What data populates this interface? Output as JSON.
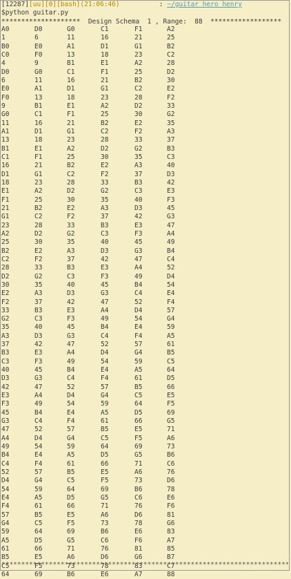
{
  "header": {
    "pid": "[12287]",
    "tag": "[uu][0][bash](21:06:46)",
    "sep": "          : ",
    "path": "~/guitar hero henry"
  },
  "command": "$python guitar.py",
  "schema_line": {
    "left_stars": "********************",
    "text": "  Design Schema  1 , Range:  88  ",
    "right_stars": "******************"
  },
  "rows": [
    [
      "A0",
      "D0",
      "G0",
      "C1",
      "F1",
      "A2"
    ],
    [
      "1",
      "6",
      "11",
      "16",
      "21",
      "25"
    ],
    [
      "B0",
      "E0",
      "A1",
      "D1",
      "G1",
      "B2"
    ],
    [
      "C0",
      "F0",
      "13",
      "18",
      "23",
      "C2"
    ],
    [
      "4",
      "9",
      "B1",
      "E1",
      "A2",
      "28"
    ],
    [
      "D0",
      "G0",
      "C1",
      "F1",
      "25",
      "D2"
    ],
    [
      "6",
      "11",
      "16",
      "21",
      "B2",
      "30"
    ],
    [
      "E0",
      "A1",
      "D1",
      "G1",
      "C2",
      "E2"
    ],
    [
      "F0",
      "13",
      "18",
      "23",
      "28",
      "F2"
    ],
    [
      "9",
      "B1",
      "E1",
      "A2",
      "D2",
      "33"
    ],
    [
      "G0",
      "C1",
      "F1",
      "25",
      "30",
      "G2"
    ],
    [
      "11",
      "16",
      "21",
      "B2",
      "E2",
      "35"
    ],
    [
      "A1",
      "D1",
      "G1",
      "C2",
      "F2",
      "A3"
    ],
    [
      "13",
      "18",
      "23",
      "28",
      "33",
      "37"
    ],
    [
      "B1",
      "E1",
      "A2",
      "D2",
      "G2",
      "B3"
    ],
    [
      "C1",
      "F1",
      "25",
      "30",
      "35",
      "C3"
    ],
    [
      "16",
      "21",
      "B2",
      "E2",
      "A3",
      "40"
    ],
    [
      "D1",
      "G1",
      "C2",
      "F2",
      "37",
      "D3"
    ],
    [
      "18",
      "23",
      "28",
      "33",
      "B3",
      "42"
    ],
    [
      "E1",
      "A2",
      "D2",
      "G2",
      "C3",
      "E3"
    ],
    [
      "F1",
      "25",
      "30",
      "35",
      "40",
      "F3"
    ],
    [
      "21",
      "B2",
      "E2",
      "A3",
      "D3",
      "45"
    ],
    [
      "G1",
      "C2",
      "F2",
      "37",
      "42",
      "G3"
    ],
    [
      "23",
      "28",
      "33",
      "B3",
      "E3",
      "47"
    ],
    [
      "A2",
      "D2",
      "G2",
      "C3",
      "F3",
      "A4"
    ],
    [
      "25",
      "30",
      "35",
      "40",
      "45",
      "49"
    ],
    [
      "B2",
      "E2",
      "A3",
      "D3",
      "G3",
      "B4"
    ],
    [
      "C2",
      "F2",
      "37",
      "42",
      "47",
      "C4"
    ],
    [
      "28",
      "33",
      "B3",
      "E3",
      "A4",
      "52"
    ],
    [
      "D2",
      "G2",
      "C3",
      "F3",
      "49",
      "D4"
    ],
    [
      "30",
      "35",
      "40",
      "45",
      "B4",
      "54"
    ],
    [
      "E2",
      "A3",
      "D3",
      "G3",
      "C4",
      "E4"
    ],
    [
      "F2",
      "37",
      "42",
      "47",
      "52",
      "F4"
    ],
    [
      "33",
      "B3",
      "E3",
      "A4",
      "D4",
      "57"
    ],
    [
      "G2",
      "C3",
      "F3",
      "49",
      "54",
      "G4"
    ],
    [
      "35",
      "40",
      "45",
      "B4",
      "E4",
      "59"
    ],
    [
      "A3",
      "D3",
      "G3",
      "C4",
      "F4",
      "A5"
    ],
    [
      "37",
      "42",
      "47",
      "52",
      "57",
      "61"
    ],
    [
      "B3",
      "E3",
      "A4",
      "D4",
      "G4",
      "B5"
    ],
    [
      "C3",
      "F3",
      "49",
      "54",
      "59",
      "C5"
    ],
    [
      "40",
      "45",
      "B4",
      "E4",
      "A5",
      "64"
    ],
    [
      "D3",
      "G3",
      "C4",
      "F4",
      "61",
      "D5"
    ],
    [
      "42",
      "47",
      "52",
      "57",
      "B5",
      "66"
    ],
    [
      "E3",
      "A4",
      "D4",
      "G4",
      "C5",
      "E5"
    ],
    [
      "F3",
      "49",
      "54",
      "59",
      "64",
      "F5"
    ],
    [
      "45",
      "B4",
      "E4",
      "A5",
      "D5",
      "69"
    ],
    [
      "G3",
      "C4",
      "F4",
      "61",
      "66",
      "G5"
    ],
    [
      "47",
      "52",
      "57",
      "B5",
      "E5",
      "71"
    ],
    [
      "A4",
      "D4",
      "G4",
      "C5",
      "F5",
      "A6"
    ],
    [
      "49",
      "54",
      "59",
      "64",
      "69",
      "73"
    ],
    [
      "B4",
      "E4",
      "A5",
      "D5",
      "G5",
      "B6"
    ],
    [
      "C4",
      "F4",
      "61",
      "66",
      "71",
      "C6"
    ],
    [
      "52",
      "57",
      "B5",
      "E5",
      "A6",
      "76"
    ],
    [
      "D4",
      "G4",
      "C5",
      "F5",
      "73",
      "D6"
    ],
    [
      "54",
      "59",
      "64",
      "69",
      "B6",
      "78"
    ],
    [
      "E4",
      "A5",
      "D5",
      "G5",
      "C6",
      "E6"
    ],
    [
      "F4",
      "61",
      "66",
      "71",
      "76",
      "F6"
    ],
    [
      "57",
      "B5",
      "E5",
      "A6",
      "D6",
      "81"
    ],
    [
      "G4",
      "C5",
      "F5",
      "73",
      "78",
      "G6"
    ],
    [
      "59",
      "64",
      "69",
      "B6",
      "E6",
      "83"
    ],
    [
      "A5",
      "D5",
      "G5",
      "C6",
      "F6",
      "A7"
    ],
    [
      "61",
      "66",
      "71",
      "76",
      "81",
      "85"
    ],
    [
      "B5",
      "E5",
      "A6",
      "D6",
      "G6",
      "B7"
    ],
    [
      "C5",
      "F5",
      "73",
      "78",
      "83",
      "C7"
    ],
    [
      "64",
      "69",
      "B6",
      "E6",
      "A7",
      "88"
    ]
  ],
  "footer": "*******************************************************************************************"
}
